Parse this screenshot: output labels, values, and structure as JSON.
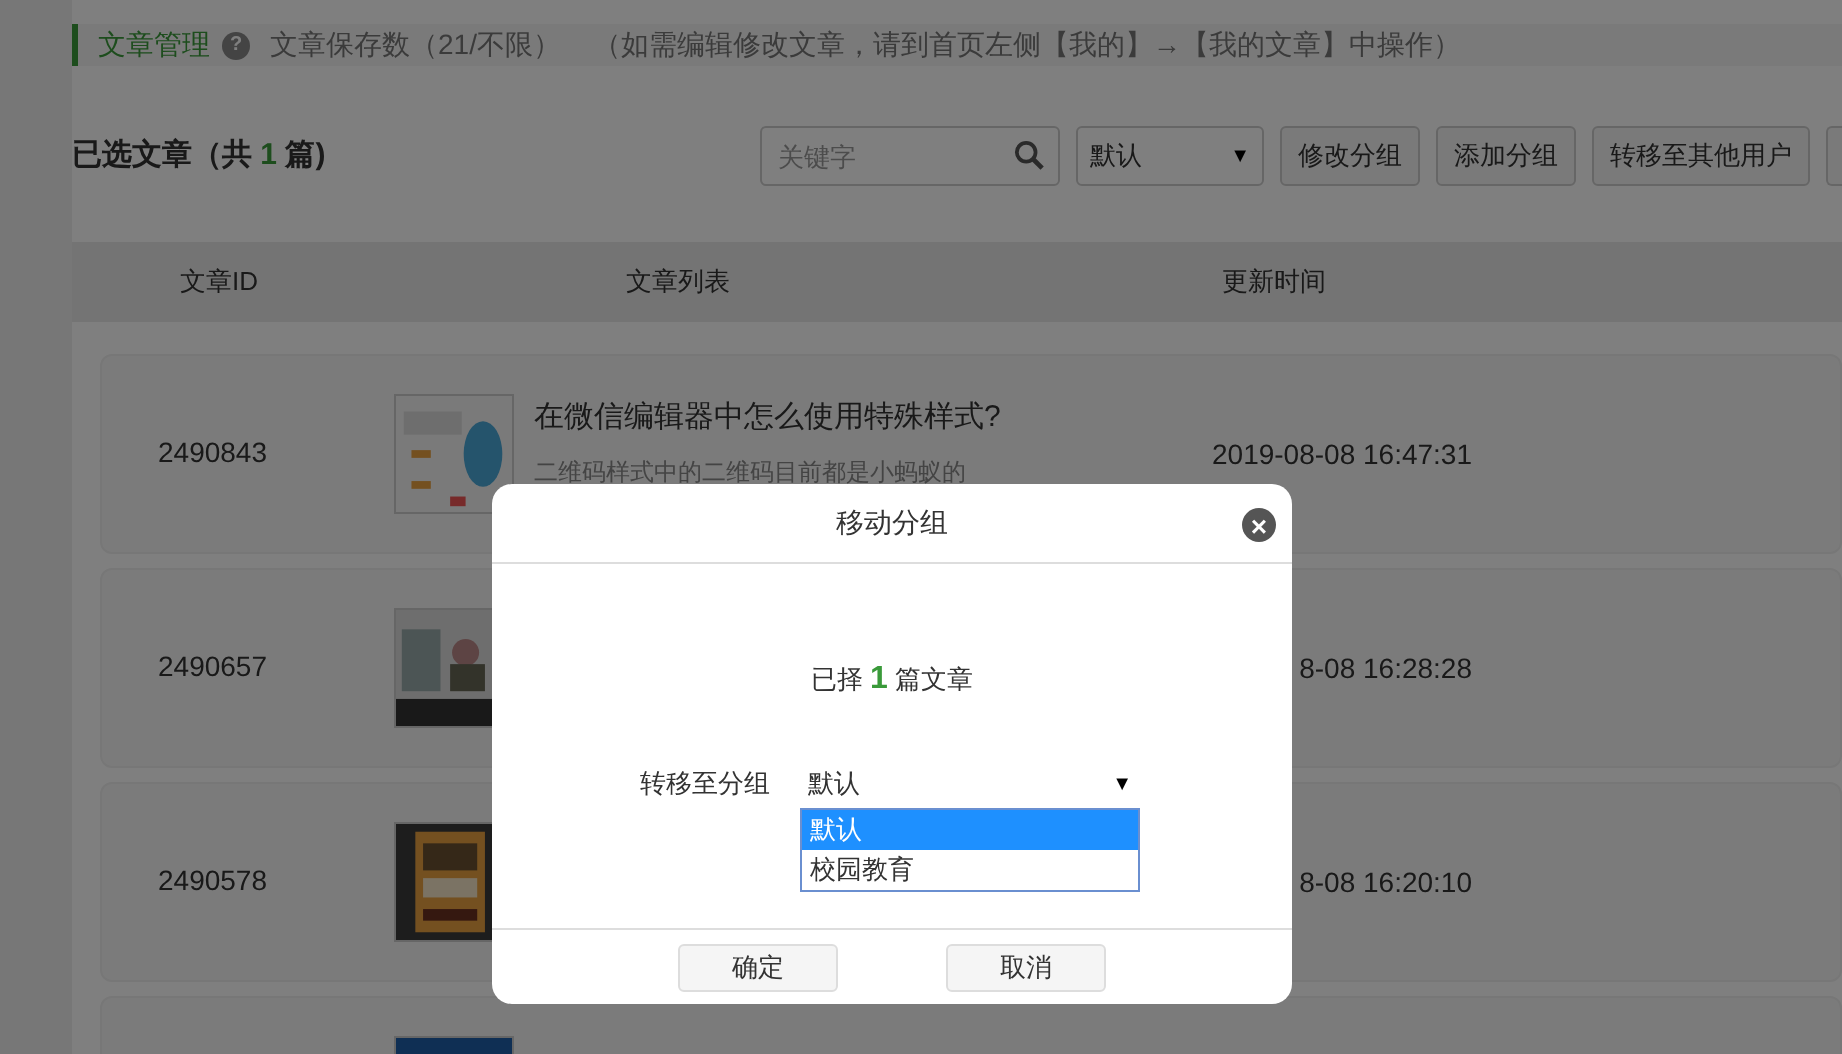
{
  "header": {
    "title": "文章管理",
    "help": "?",
    "saved_count": "文章保存数（21/不限）",
    "note": "（如需编辑修改文章，请到首页左侧【我的】→【我的文章】中操作）"
  },
  "selection": {
    "prefix": "已选文章（共",
    "count": "1",
    "suffix": "篇)"
  },
  "toolbar": {
    "search": {
      "placeholder": "关键字"
    },
    "group_select": {
      "value": "默认",
      "arrow": "▼"
    },
    "buttons": [
      "修改分组",
      "添加分组",
      "转移至其他用户"
    ]
  },
  "table": {
    "columns": [
      "文章ID",
      "文章列表",
      "更新时间"
    ],
    "rows": [
      {
        "id": "2490843",
        "title": "在微信编辑器中怎么使用特殊样式?",
        "summary": "二维码样式中的二维码目前都是小蚂蚁的",
        "time": "2019-08-08 16:47:31",
        "kind": "picture"
      },
      {
        "id": "2490657",
        "time": "8-08 16:28:28",
        "kind": "picture"
      },
      {
        "id": "2490578",
        "time": "8-08 16:20:10",
        "kind": "picture"
      },
      {
        "kind": "picture"
      }
    ]
  },
  "dialog": {
    "title": "移动分组",
    "close": "×",
    "count_prefix": "已择",
    "count": "1",
    "count_suffix": "篇文章",
    "field_label": "转移至分组",
    "select": {
      "value": "默认",
      "arrow": "▼",
      "expanded": true,
      "options": [
        {
          "label": "默认",
          "selected": true
        },
        {
          "label": "校园教育",
          "selected": false
        }
      ]
    },
    "buttons": [
      "确定",
      "取消"
    ]
  }
}
